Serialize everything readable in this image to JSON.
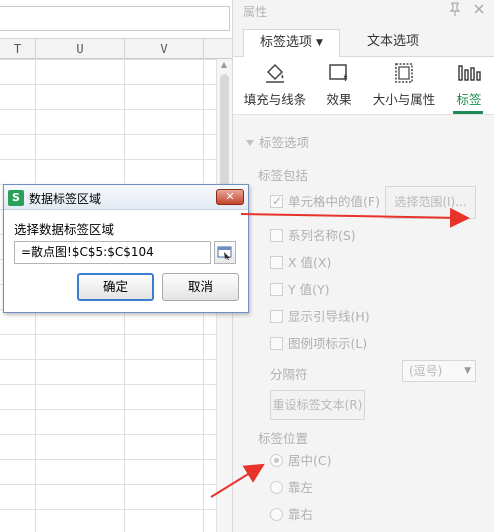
{
  "spreadsheet": {
    "columns": [
      "T",
      "U",
      "V"
    ]
  },
  "panel": {
    "title": "属性",
    "tabs": {
      "label_options": "标签选项",
      "text_options": "文本选项"
    },
    "categories": [
      "填充与线条",
      "效果",
      "大小与属性",
      "标签"
    ],
    "active_category": "标签",
    "section_label_options": "标签选项",
    "label_contains": "标签包括",
    "checkboxes": [
      {
        "label": "单元格中的值(F)",
        "checked": true
      },
      {
        "label": "系列名称(S)",
        "checked": false
      },
      {
        "label": "X 值(X)",
        "checked": false
      },
      {
        "label": "Y 值(Y)",
        "checked": false
      },
      {
        "label": "显示引导线(H)",
        "checked": false
      },
      {
        "label": "图例项标示(L)",
        "checked": false
      }
    ],
    "select_range_button": "选择范围(I)...",
    "separator_label": "分隔符",
    "separator_value": "(逗号)",
    "reset_button": "重设标签文本(R)",
    "label_position": "标签位置",
    "positions": [
      {
        "label": "居中(C)",
        "selected": true
      },
      {
        "label": "靠左",
        "selected": false
      },
      {
        "label": "靠右",
        "selected": false
      }
    ]
  },
  "dialog": {
    "title": "数据标签区域",
    "prompt": "选择数据标签区域",
    "input_value": "=散点图!$C$5:$C$104",
    "ok": "确定",
    "cancel": "取消",
    "close_glyph": "✕",
    "app_icon_glyph": "S"
  },
  "colors": {
    "accent": "#1f8a53",
    "annotation_arrow": "#e8322a",
    "dialog_border": "#6f8fbf"
  }
}
